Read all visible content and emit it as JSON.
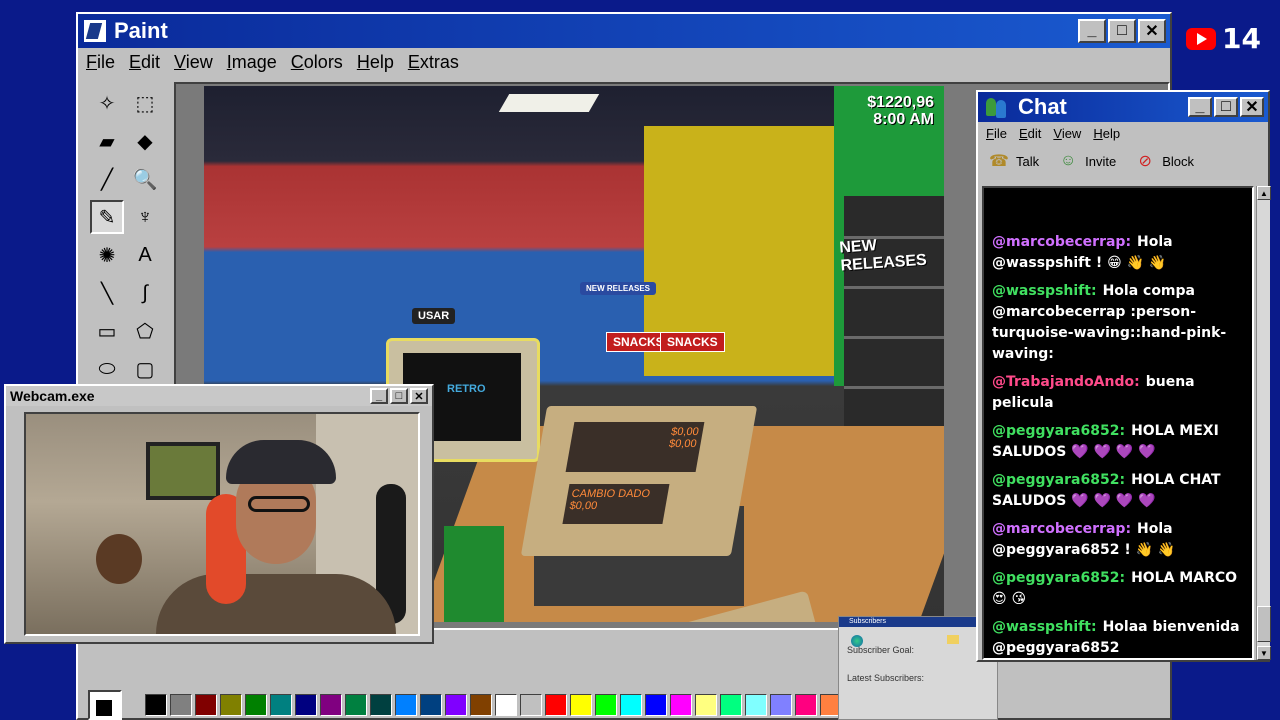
{
  "youtube": {
    "count": "14",
    "accent": "#ff0000"
  },
  "paint": {
    "title": "Paint",
    "menu": [
      "File",
      "Edit",
      "View",
      "Image",
      "Colors",
      "Help",
      "Extras"
    ],
    "window_buttons": [
      "_",
      "□",
      "✕"
    ],
    "tools": [
      {
        "icon": "free-select-icon",
        "glyph": "✧"
      },
      {
        "icon": "rect-select-icon",
        "glyph": "⬚"
      },
      {
        "icon": "eraser-icon",
        "glyph": "▰"
      },
      {
        "icon": "fill-bucket-icon",
        "glyph": "◆"
      },
      {
        "icon": "color-picker-icon",
        "glyph": "╱"
      },
      {
        "icon": "magnifier-icon",
        "glyph": "🔍"
      },
      {
        "icon": "pencil-icon",
        "glyph": "✎"
      },
      {
        "icon": "brush-icon",
        "glyph": "♆"
      },
      {
        "icon": "airbrush-icon",
        "glyph": "✺"
      },
      {
        "icon": "text-icon",
        "glyph": "A"
      },
      {
        "icon": "line-icon",
        "glyph": "╲"
      },
      {
        "icon": "curve-icon",
        "glyph": "∫"
      },
      {
        "icon": "rectangle-icon",
        "glyph": "▭"
      },
      {
        "icon": "polygon-icon",
        "glyph": "⬠"
      },
      {
        "icon": "ellipse-icon",
        "glyph": "⬭"
      },
      {
        "icon": "rounded-rect-icon",
        "glyph": "▢"
      }
    ],
    "active_tool": "pencil-icon",
    "palette": [
      "#000000",
      "#808080",
      "#800000",
      "#808000",
      "#008000",
      "#008080",
      "#000080",
      "#800080",
      "#008040",
      "#004040",
      "#0080ff",
      "#004080",
      "#8000ff",
      "#804000",
      "#ffffff",
      "#c0c0c0",
      "#ff0000",
      "#ffff00",
      "#00ff00",
      "#00ffff",
      "#0000ff",
      "#ff00ff",
      "#ffff80",
      "#00ff80",
      "#80ffff",
      "#8080ff",
      "#ff0080",
      "#ff8040"
    ]
  },
  "game": {
    "money": "$1220,96",
    "time": "8:00 AM",
    "sign_usar": "USAR",
    "sign_snacks_1": "SNACKS",
    "sign_snacks_2": "SNACKS",
    "sign_new_releases": "NEW RELEASES",
    "sign_new_releases_small": "NEW RELEASES",
    "register_display_1": "$0,00",
    "register_display_2": "$0,00",
    "register_change_label": "CAMBIO DADO",
    "register_change_value": "$0,00",
    "monitor_text": "RETRO"
  },
  "subscribers": {
    "title": "Subscribers",
    "goal_label": "Subscriber Goal:",
    "latest_label": "Latest Subscribers:"
  },
  "webcam": {
    "title": "Webcam.exe"
  },
  "chat": {
    "title": "Chat",
    "menu": [
      "File",
      "Edit",
      "View",
      "Help"
    ],
    "tools": [
      {
        "label": "Talk",
        "icon": "talk-icon"
      },
      {
        "label": "Invite",
        "icon": "invite-icon"
      },
      {
        "label": "Block",
        "icon": "block-icon"
      }
    ],
    "messages": [
      {
        "user": "@marcobecerrap:",
        "text": "Hola @wasspshift ! 😁 👋 👋",
        "color": "#d070ff"
      },
      {
        "user": "@wasspshift:",
        "text": "Hola compa @marcobecerrap :person-turquoise-waving::hand-pink-waving:",
        "color": "#40e060"
      },
      {
        "user": "@TrabajandoAndo:",
        "text": "buena pelicula",
        "color": "#ff4a8a"
      },
      {
        "user": "@peggyara6852:",
        "text": "HOLA MEXI SALUDOS 💜 💜 💜 💜",
        "color": "#40e060"
      },
      {
        "user": "@peggyara6852:",
        "text": "HOLA CHAT SALUDOS 💜 💜 💜 💜",
        "color": "#40e060"
      },
      {
        "user": "@marcobecerrap:",
        "text": "Hola @peggyara6852 ! 👋 👋",
        "color": "#d070ff"
      },
      {
        "user": "@peggyara6852:",
        "text": "HOLA MARCO 😍 😘",
        "color": "#40e060"
      },
      {
        "user": "@wasspshift:",
        "text": "Holaa bienvenida @peggyara6852",
        "color": "#40e060"
      }
    ]
  }
}
